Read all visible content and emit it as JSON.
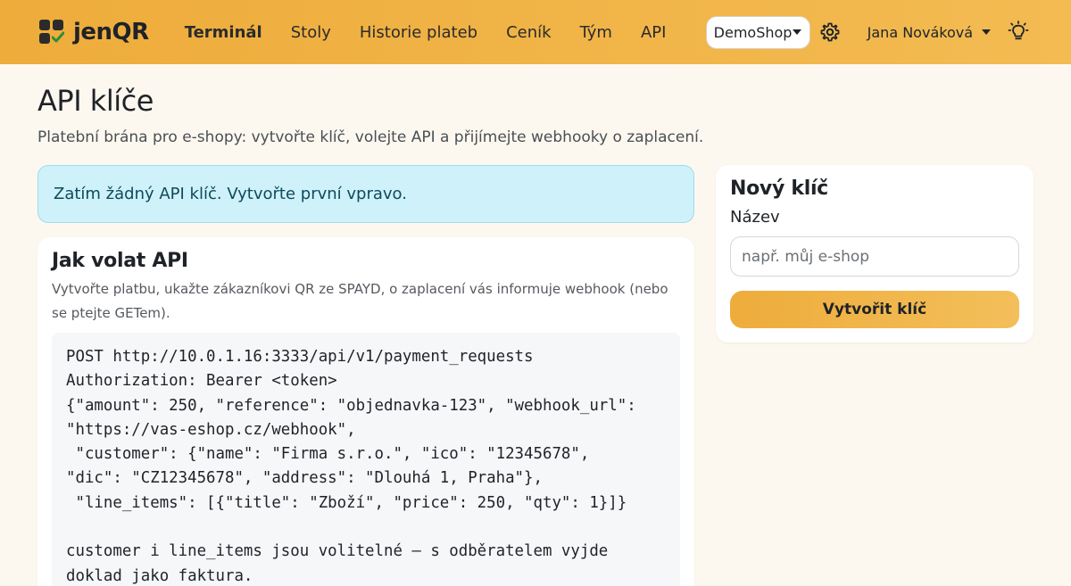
{
  "brand": {
    "name": "jenQR",
    "logo_icon": "qr-check-logo-icon"
  },
  "nav": {
    "links": [
      "Terminál",
      "Stoly",
      "Historie plateb",
      "Ceník",
      "Tým",
      "API"
    ],
    "active": "Terminál"
  },
  "header": {
    "shop": "DemoShop",
    "user": "Jana Nováková",
    "settings_icon": "gear-icon",
    "theme_icon": "lightbulb-icon"
  },
  "page": {
    "title": "API klíče",
    "subtitle": "Platební brána pro e-shopy: vytvořte klíč, volejte API a přijímejte webhooky o zaplacení."
  },
  "alert": {
    "text": "Zatím žádný API klíč. Vytvořte první vpravo."
  },
  "api_card": {
    "title": "Jak volat API",
    "description": "Vytvořte platbu, ukažte zákazníkovi QR ze SPAYD, o zaplacení vás informuje webhook (nebo se ptejte GETem).",
    "code": "POST http://10.0.1.16:3333/api/v1/payment_requests\nAuthorization: Bearer <token>\n{\"amount\": 250, \"reference\": \"objednavka-123\", \"webhook_url\":\n\"https://vas-eshop.cz/webhook\",\n \"customer\": {\"name\": \"Firma s.r.o.\", \"ico\": \"12345678\",\n\"dic\": \"CZ12345678\", \"address\": \"Dlouhá 1, Praha\"},\n \"line_items\": [{\"title\": \"Zboží\", \"price\": 250, \"qty\": 1}]}\n\ncustomer i line_items jsou volitelné — s odběratelem vyjde\ndoklad jako faktura."
  },
  "new_key": {
    "title": "Nový klíč",
    "name_label": "Název",
    "name_placeholder": "např. můj e-shop",
    "name_value": "",
    "submit_label": "Vytvořit klíč"
  },
  "colors": {
    "accent": "#eeac3b",
    "accent_light": "#f3bb52",
    "alert_bg": "#cff1fa",
    "background": "#fdf8ef"
  }
}
